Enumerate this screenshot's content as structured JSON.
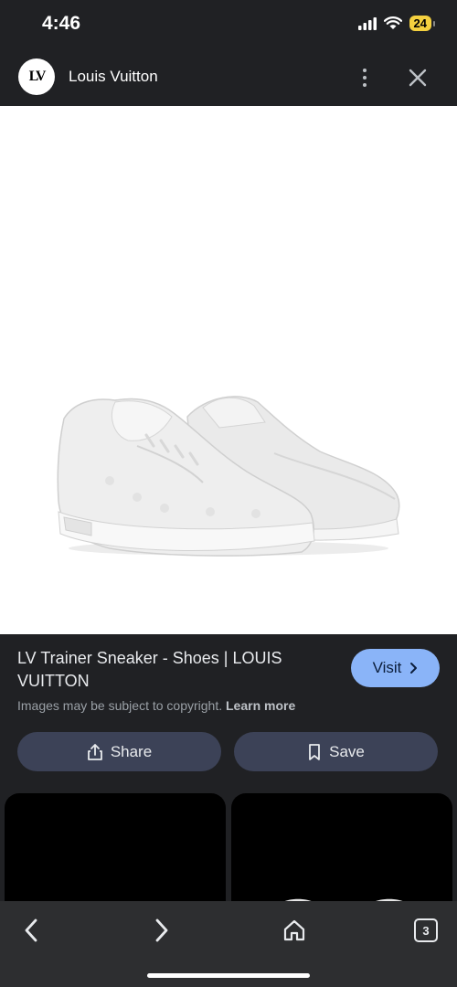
{
  "status_bar": {
    "time": "4:46",
    "battery": "24"
  },
  "header": {
    "site_name": "Louis Vuitton",
    "logo_text": "LV"
  },
  "result": {
    "title": "LV Trainer Sneaker - Shoes | LOUIS VUITTON",
    "visit_label": "Visit",
    "copyright_text": "Images may be subject to copyright.",
    "learn_more_label": "Learn more"
  },
  "actions": {
    "share_label": "Share",
    "save_label": "Save"
  },
  "bottom_nav": {
    "tab_count": "3"
  },
  "icons": {
    "back": "chevron-left-icon",
    "forward": "chevron-right-icon",
    "home": "home-icon",
    "share": "share-icon",
    "save": "bookmark-icon",
    "close": "close-icon",
    "more": "more-vert-icon"
  },
  "colors": {
    "visit_button": "#8ab4f8",
    "action_button": "#3c4257",
    "background": "#202124"
  }
}
